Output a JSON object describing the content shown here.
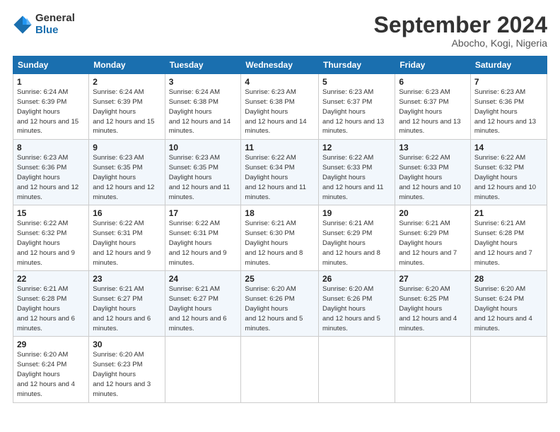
{
  "logo": {
    "general": "General",
    "blue": "Blue"
  },
  "title": "September 2024",
  "subtitle": "Abocho, Kogi, Nigeria",
  "days": [
    "Sunday",
    "Monday",
    "Tuesday",
    "Wednesday",
    "Thursday",
    "Friday",
    "Saturday"
  ],
  "weeks": [
    [
      {
        "day": "1",
        "sunrise": "6:24 AM",
        "sunset": "6:39 PM",
        "daylight": "12 hours and 15 minutes."
      },
      {
        "day": "2",
        "sunrise": "6:24 AM",
        "sunset": "6:39 PM",
        "daylight": "12 hours and 15 minutes."
      },
      {
        "day": "3",
        "sunrise": "6:24 AM",
        "sunset": "6:38 PM",
        "daylight": "12 hours and 14 minutes."
      },
      {
        "day": "4",
        "sunrise": "6:23 AM",
        "sunset": "6:38 PM",
        "daylight": "12 hours and 14 minutes."
      },
      {
        "day": "5",
        "sunrise": "6:23 AM",
        "sunset": "6:37 PM",
        "daylight": "12 hours and 13 minutes."
      },
      {
        "day": "6",
        "sunrise": "6:23 AM",
        "sunset": "6:37 PM",
        "daylight": "12 hours and 13 minutes."
      },
      {
        "day": "7",
        "sunrise": "6:23 AM",
        "sunset": "6:36 PM",
        "daylight": "12 hours and 13 minutes."
      }
    ],
    [
      {
        "day": "8",
        "sunrise": "6:23 AM",
        "sunset": "6:36 PM",
        "daylight": "12 hours and 12 minutes."
      },
      {
        "day": "9",
        "sunrise": "6:23 AM",
        "sunset": "6:35 PM",
        "daylight": "12 hours and 12 minutes."
      },
      {
        "day": "10",
        "sunrise": "6:23 AM",
        "sunset": "6:35 PM",
        "daylight": "12 hours and 11 minutes."
      },
      {
        "day": "11",
        "sunrise": "6:22 AM",
        "sunset": "6:34 PM",
        "daylight": "12 hours and 11 minutes."
      },
      {
        "day": "12",
        "sunrise": "6:22 AM",
        "sunset": "6:33 PM",
        "daylight": "12 hours and 11 minutes."
      },
      {
        "day": "13",
        "sunrise": "6:22 AM",
        "sunset": "6:33 PM",
        "daylight": "12 hours and 10 minutes."
      },
      {
        "day": "14",
        "sunrise": "6:22 AM",
        "sunset": "6:32 PM",
        "daylight": "12 hours and 10 minutes."
      }
    ],
    [
      {
        "day": "15",
        "sunrise": "6:22 AM",
        "sunset": "6:32 PM",
        "daylight": "12 hours and 9 minutes."
      },
      {
        "day": "16",
        "sunrise": "6:22 AM",
        "sunset": "6:31 PM",
        "daylight": "12 hours and 9 minutes."
      },
      {
        "day": "17",
        "sunrise": "6:22 AM",
        "sunset": "6:31 PM",
        "daylight": "12 hours and 9 minutes."
      },
      {
        "day": "18",
        "sunrise": "6:21 AM",
        "sunset": "6:30 PM",
        "daylight": "12 hours and 8 minutes."
      },
      {
        "day": "19",
        "sunrise": "6:21 AM",
        "sunset": "6:29 PM",
        "daylight": "12 hours and 8 minutes."
      },
      {
        "day": "20",
        "sunrise": "6:21 AM",
        "sunset": "6:29 PM",
        "daylight": "12 hours and 7 minutes."
      },
      {
        "day": "21",
        "sunrise": "6:21 AM",
        "sunset": "6:28 PM",
        "daylight": "12 hours and 7 minutes."
      }
    ],
    [
      {
        "day": "22",
        "sunrise": "6:21 AM",
        "sunset": "6:28 PM",
        "daylight": "12 hours and 6 minutes."
      },
      {
        "day": "23",
        "sunrise": "6:21 AM",
        "sunset": "6:27 PM",
        "daylight": "12 hours and 6 minutes."
      },
      {
        "day": "24",
        "sunrise": "6:21 AM",
        "sunset": "6:27 PM",
        "daylight": "12 hours and 6 minutes."
      },
      {
        "day": "25",
        "sunrise": "6:20 AM",
        "sunset": "6:26 PM",
        "daylight": "12 hours and 5 minutes."
      },
      {
        "day": "26",
        "sunrise": "6:20 AM",
        "sunset": "6:26 PM",
        "daylight": "12 hours and 5 minutes."
      },
      {
        "day": "27",
        "sunrise": "6:20 AM",
        "sunset": "6:25 PM",
        "daylight": "12 hours and 4 minutes."
      },
      {
        "day": "28",
        "sunrise": "6:20 AM",
        "sunset": "6:24 PM",
        "daylight": "12 hours and 4 minutes."
      }
    ],
    [
      {
        "day": "29",
        "sunrise": "6:20 AM",
        "sunset": "6:24 PM",
        "daylight": "12 hours and 4 minutes."
      },
      {
        "day": "30",
        "sunrise": "6:20 AM",
        "sunset": "6:23 PM",
        "daylight": "12 hours and 3 minutes."
      },
      null,
      null,
      null,
      null,
      null
    ]
  ]
}
